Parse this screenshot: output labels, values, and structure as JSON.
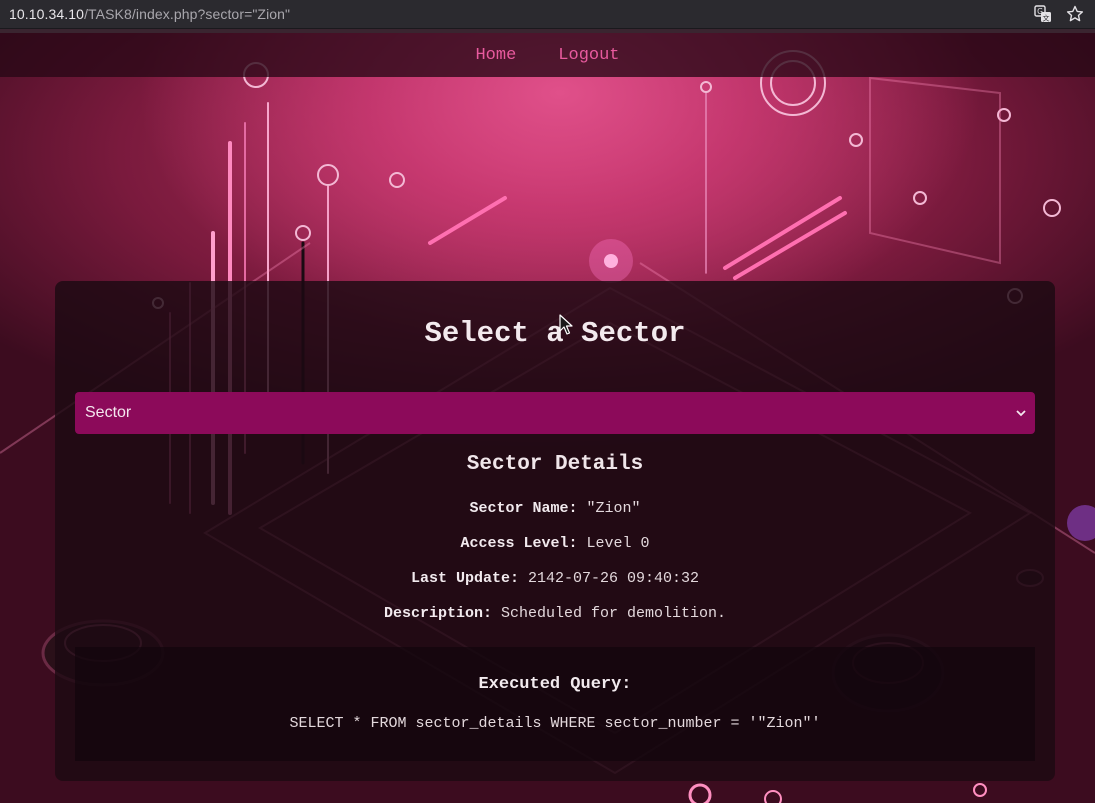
{
  "browser": {
    "url_host": "10.10.34.10",
    "url_path": "/TASK8/index.php?sector=\"Zion\"",
    "icons": [
      "translate-icon",
      "bookmark-star-icon"
    ]
  },
  "nav": {
    "home_label": "Home",
    "logout_label": "Logout"
  },
  "main": {
    "title": "Select a Sector",
    "select": {
      "selected_value": "Sector"
    },
    "details": {
      "title": "Sector Details",
      "rows": [
        {
          "key": "Sector Name:",
          "value": "\"Zion\""
        },
        {
          "key": "Access Level:",
          "value": "Level 0"
        },
        {
          "key": "Last Update:",
          "value": "2142-07-26 09:40:32"
        },
        {
          "key": "Description:",
          "value": "Scheduled for demolition."
        }
      ]
    },
    "query": {
      "title": "Executed Query:",
      "text": "SELECT * FROM sector_details WHERE sector_number = '\"Zion\"'"
    }
  },
  "colors": {
    "accent_pink": "#e85a9e",
    "select_bg": "#8c0a5a",
    "panel_bg": "#1c0a12"
  }
}
